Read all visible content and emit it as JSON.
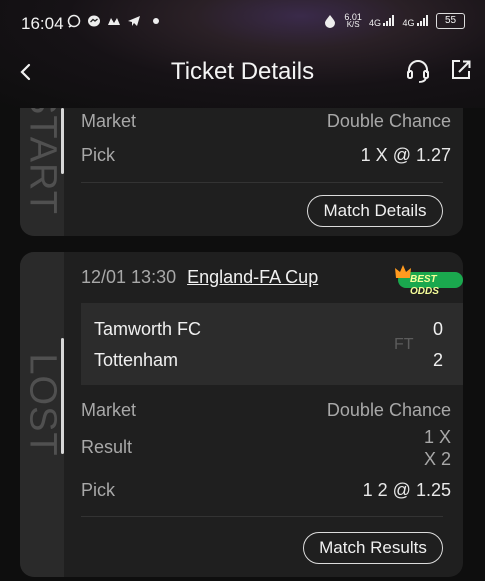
{
  "status_bar": {
    "time": "16:04",
    "net_speed_value": "6.01",
    "net_speed_unit": "K/S",
    "signal1_label": "4G",
    "signal2_label": "4G",
    "battery": "55"
  },
  "header": {
    "title": "Ticket Details"
  },
  "ticket1": {
    "status_label": "START",
    "market_label": "Market",
    "market_value": "Double Chance",
    "pick_label": "Pick",
    "pick_value": "1 X @ 1.27",
    "button_label": "Match Details"
  },
  "ticket2": {
    "status_label": "LOST",
    "datetime": "12/01 13:30",
    "league": "England-FA Cup",
    "badge": "BEST ODDS",
    "home_team": "Tamworth FC",
    "away_team": "Tottenham",
    "home_score": "0",
    "away_score": "2",
    "match_status": "FT",
    "market_label": "Market",
    "market_value": "Double Chance",
    "result_label": "Result",
    "result_line1": "1 X",
    "result_line2": "X 2",
    "pick_label": "Pick",
    "pick_value": "1 2 @ 1.25",
    "button_label": "Match Results"
  },
  "colors": {
    "badge_bg": "#1aa84e",
    "card_bg": "#1f1f1f",
    "page_bg": "#0e0e0e"
  }
}
